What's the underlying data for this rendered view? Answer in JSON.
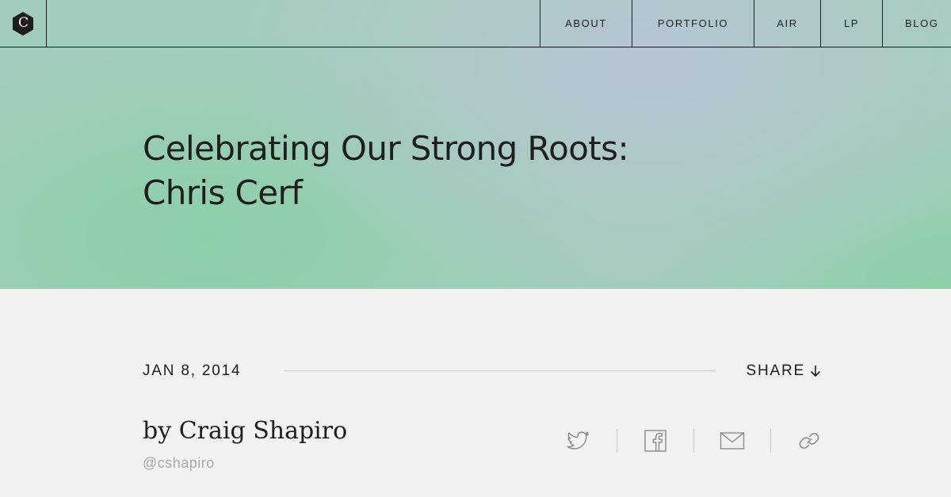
{
  "header": {
    "logo_letter": "C",
    "nav": [
      {
        "label": "ABOUT"
      },
      {
        "label": "PORTFOLIO"
      },
      {
        "label": "AIR"
      },
      {
        "label": "LP"
      },
      {
        "label": "BLOG"
      }
    ]
  },
  "hero": {
    "title_line1": "Celebrating Our Strong Roots:",
    "title_line2": "Chris Cerf"
  },
  "post": {
    "date": "JAN 8, 2014",
    "share_label": "SHARE",
    "author": "by Craig Shapiro",
    "handle": "@cshapiro",
    "share_icons": [
      "twitter-icon",
      "facebook-icon",
      "email-icon",
      "link-icon"
    ]
  },
  "colors": {
    "text": "#1e1e1e",
    "page_bg": "#f2f2f2",
    "hero_green": "#8ad0a6",
    "hero_blue_grey": "#b8c4d4",
    "muted": "#a8a8a8",
    "rule": "#c8c8c8"
  }
}
